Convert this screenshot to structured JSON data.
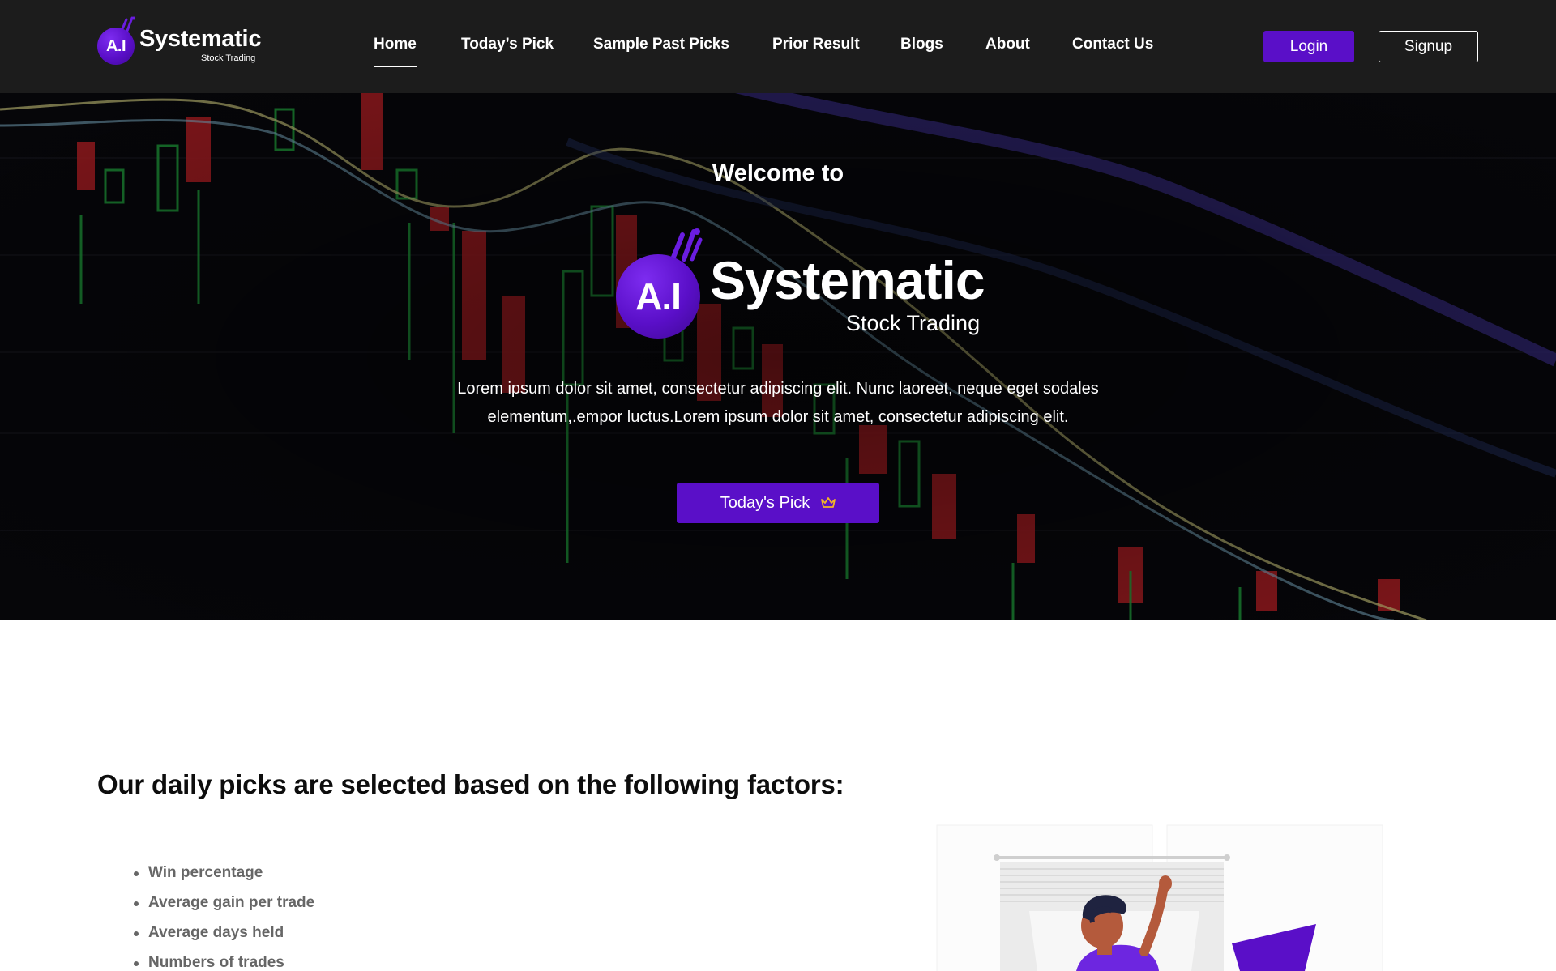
{
  "brand": {
    "badge_text": "A.I",
    "name": "Systematic",
    "tagline": "Stock Trading",
    "primary_color": "#5a0fc8"
  },
  "nav": {
    "items": [
      {
        "label": "Home",
        "active": true
      },
      {
        "label": "Today’s Pick"
      },
      {
        "label": "Sample Past Picks"
      },
      {
        "label": "Prior Result"
      },
      {
        "label": "Blogs"
      },
      {
        "label": "About"
      },
      {
        "label": "Contact Us"
      }
    ],
    "login_label": "Login",
    "signup_label": "Signup"
  },
  "hero": {
    "welcome": "Welcome to",
    "logo_badge": "A.I",
    "logo_name": "Systematic",
    "logo_sub": "Stock Trading",
    "description": "Lorem ipsum dolor sit amet, consectetur adipiscing elit. Nunc laoreet, neque eget sodales elementum,.empor luctus.Lorem ipsum dolor sit amet, consectetur adipiscing elit.",
    "cta_label": "Today's Pick",
    "cta_icon": "crown-icon"
  },
  "factors": {
    "title": "Our daily picks are selected based on the following factors:",
    "items": [
      "Win percentage",
      "Average gain per trade",
      "Average days held",
      "Numbers of trades"
    ]
  }
}
